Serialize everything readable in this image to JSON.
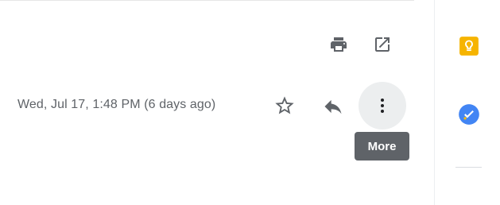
{
  "toolbar": {
    "print_icon": "print-icon",
    "open_in_new_icon": "open-in-new-window-icon"
  },
  "message": {
    "date": "Wed, Jul 17, 1:48 PM (6 days ago)",
    "star_icon": "star-outline-icon",
    "reply_icon": "reply-icon",
    "more_icon": "more-vertical-icon"
  },
  "tooltip": {
    "label": "More"
  },
  "side_panel": {
    "keep_icon": "google-keep-icon",
    "tasks_icon": "google-tasks-icon"
  },
  "colors": {
    "text_secondary": "#5f6368",
    "icon_gray": "#5f6368",
    "tooltip_bg": "#5f6368",
    "hover_circle": "#eceeef",
    "keep_yellow": "#f6b400",
    "tasks_blue": "#4285f4"
  }
}
